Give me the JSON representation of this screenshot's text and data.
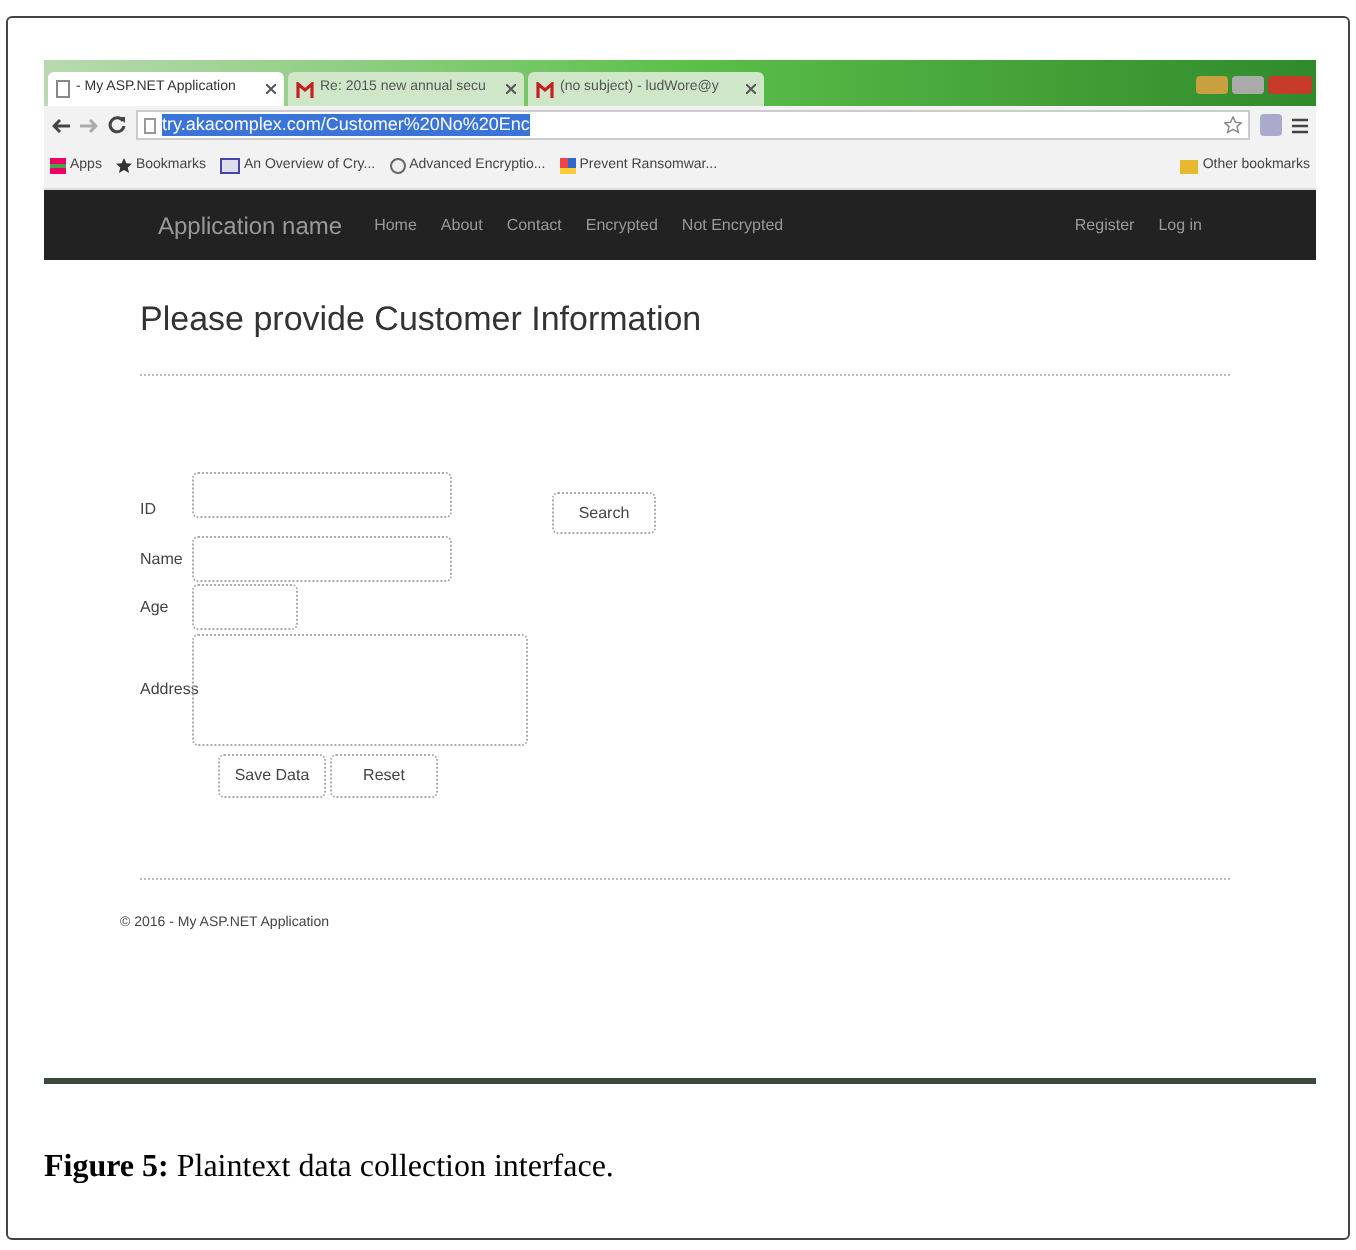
{
  "browser": {
    "tabs": [
      {
        "title": "- My ASP.NET Application",
        "kind": "page",
        "selected": true
      },
      {
        "title": "Re: 2015 new annual secu",
        "kind": "mail",
        "selected": false
      },
      {
        "title": "(no subject) - ludWore@y",
        "kind": "mail",
        "selected": false
      }
    ],
    "address": "try.akacomplex.com/Customer%20No%20Enc",
    "bookmarks": [
      {
        "label": "Apps",
        "kind": "apps"
      },
      {
        "label": "Bookmarks",
        "kind": "star"
      },
      {
        "label": "An Overview of Cry...",
        "kind": "doc"
      },
      {
        "label": "Advanced Encryptio...",
        "kind": "wiki"
      },
      {
        "label": "Prevent Ransomwar...",
        "kind": "color"
      }
    ],
    "other_bookmarks": "Other bookmarks"
  },
  "navbar": {
    "brand": "Application name",
    "links": [
      "Home",
      "About",
      "Contact",
      "Encrypted",
      "Not Encrypted"
    ],
    "right_links": [
      "Register",
      "Log in"
    ]
  },
  "page": {
    "heading": "Please provide Customer Information",
    "fields": [
      {
        "label": "ID",
        "kind": "text"
      },
      {
        "label": "Name",
        "kind": "text"
      },
      {
        "label": "Age",
        "kind": "short"
      },
      {
        "label": "Address",
        "kind": "textarea"
      }
    ],
    "search_button": "Search",
    "buttons": [
      "Save Data",
      "Reset"
    ],
    "footer": "© 2016 - My ASP.NET Application"
  },
  "caption": "**Figure 5:** Plaintext data collection interface."
}
